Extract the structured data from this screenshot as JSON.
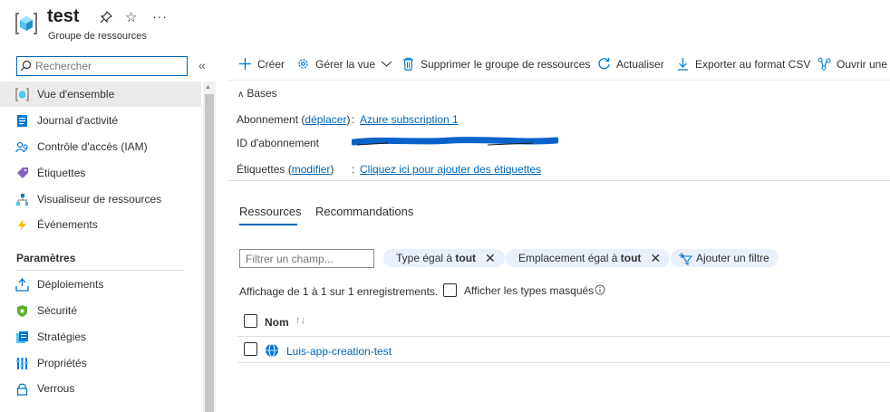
{
  "header": {
    "title": "test",
    "subtitle": "Groupe de ressources",
    "more": "···"
  },
  "nav": {
    "search_placeholder": "Rechercher",
    "items": [
      {
        "label": "Vue d'ensemble",
        "icon": "resource-group-icon",
        "selected": true
      },
      {
        "label": "Journal d'activité",
        "icon": "activity-log-icon"
      },
      {
        "label": "Contrôle d'accès (IAM)",
        "icon": "iam-icon"
      },
      {
        "label": "Étiquettes",
        "icon": "tag-icon"
      },
      {
        "label": "Visualiseur de ressources",
        "icon": "resource-visualizer-icon"
      },
      {
        "label": "Événements",
        "icon": "events-icon"
      }
    ],
    "section_title": "Paramètres",
    "settings_items": [
      {
        "label": "Déploiements",
        "icon": "deployments-icon"
      },
      {
        "label": "Sécurité",
        "icon": "security-icon"
      },
      {
        "label": "Stratégies",
        "icon": "policies-icon"
      },
      {
        "label": "Propriétés",
        "icon": "properties-icon"
      },
      {
        "label": "Verrous",
        "icon": "locks-icon"
      }
    ]
  },
  "toolbar": {
    "create": "Créer",
    "manage_view": "Gérer la vue",
    "delete": "Supprimer le groupe de ressources",
    "refresh": "Actualiser",
    "export": "Exporter au format CSV",
    "open": "Ouvrir une"
  },
  "essentials": {
    "title": "Bases",
    "subscription_label": "Abonnement",
    "move_link": "déplacer",
    "subscription_value": "Azure subscription 1",
    "subscription_id_label": "ID d'abonnement",
    "tags_label": "Étiquettes",
    "modify_link": "modifier",
    "tags_value": "Cliquez ici pour ajouter des étiquettes"
  },
  "tabs": {
    "resources": "Ressources",
    "recommendations": "Recommandations"
  },
  "filters": {
    "field_placeholder": "Filtrer un champ...",
    "type_prefix": "Type égal à",
    "type_value": "tout",
    "location_prefix": "Emplacement égal à",
    "location_value": "tout",
    "add_filter": "Ajouter un filtre"
  },
  "records": {
    "count_text": "Affichage de 1 à 1 sur 1 enregistrements.",
    "show_hidden": "Afficher les types masqués"
  },
  "grid": {
    "column_name": "Nom",
    "rows": [
      {
        "name": "Luis-app-creation-test",
        "icon": "app-service-icon"
      }
    ]
  },
  "colors": {
    "accent": "#0066b8",
    "selected_nav": "#edebe9",
    "pill_bg": "#e8f0fb"
  }
}
